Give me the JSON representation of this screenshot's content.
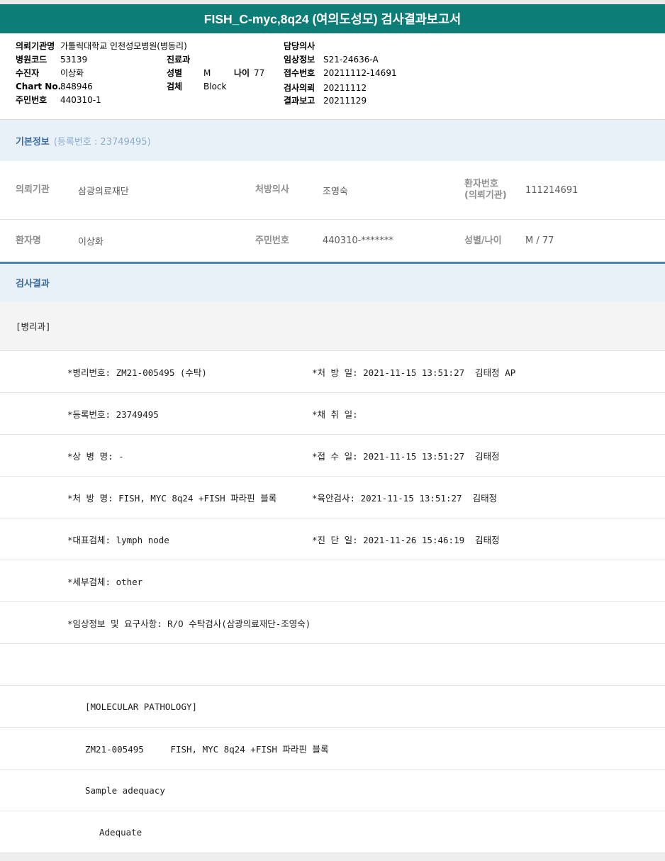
{
  "report": {
    "title": "FISH_C-myc,8q24 (여의도성모) 검사결과보고서"
  },
  "patient_header": {
    "org_label": "의뢰기관명",
    "org_value": "가톨릭대학교 인천성모병원(병동리)",
    "hospital_code_label": "병원코드",
    "hospital_code_value": "53139",
    "examinee_label": "수진자",
    "examinee_value": "이상화",
    "chart_no_label": "Chart No.",
    "chart_no_value": "848946",
    "resident_no_label": "주민번호",
    "resident_no_value": "440310-1",
    "dept_label": "진료과",
    "dept_value": "",
    "sex_label": "성별",
    "sex_value": "M",
    "age_label": "나이",
    "age_value": "77",
    "specimen_label": "검체",
    "specimen_value": "Block",
    "doctor_label": "담당의사",
    "doctor_value": "",
    "clinical_info_label": "임상정보",
    "clinical_info_value": "S21-24636-A",
    "accession_label": "접수번호",
    "accession_value": "20211112-14691",
    "request_label": "검사의뢰",
    "request_value": "20211112",
    "reported_label": "결과보고",
    "reported_value": "20211129"
  },
  "basic_info": {
    "title": "기본정보",
    "subtitle": "(등록번호 : 23749495)",
    "row1": {
      "c1_label": "의뢰기관",
      "c1_value": "삼광의료재단",
      "c2_label": "처방의사",
      "c2_value": "조영숙",
      "c3_label": "환자번호",
      "c3_label_sub": "(의뢰기관)",
      "c3_value": "111214691"
    },
    "row2": {
      "c1_label": "환자명",
      "c1_value": "이상화",
      "c2_label": "주민번호",
      "c2_value": "440310-*******",
      "c3_label": "성별/나이",
      "c3_label_sub": "",
      "c3_value": "M / 77"
    }
  },
  "results": {
    "title": "검사결과",
    "department": "[병리과]",
    "rows": [
      {
        "left": "*병리번호: ZM21-005495 (수탁)",
        "right": "*처 방 일: 2021-11-15 13:51:27  김태정 AP"
      },
      {
        "left": "*등록번호: 23749495",
        "right": "*채 취 일:"
      },
      {
        "left": "*상 병 명: -",
        "right": "*접 수 일: 2021-11-15 13:51:27  김태정"
      },
      {
        "left": "*처 방 명: FISH, MYC 8q24 +FISH 파라핀 블록",
        "right": "*육안검사: 2021-11-15 13:51:27  김태정"
      },
      {
        "left": "*대표검체: lymph node",
        "right": "*진 단 일: 2021-11-26 15:46:19  김태정"
      },
      {
        "left": "*세부검체: other",
        "right": ""
      },
      {
        "left": "*임상정보 및 요구사항: R/O 수탁검사(삼광의료재단-조영숙)",
        "right": ""
      },
      {
        "left": "",
        "right": ""
      },
      {
        "left": "[MOLECULAR PATHOLOGY]",
        "right": ""
      },
      {
        "left": "ZM21-005495     FISH, MYC 8q24 +FISH 파라핀 블록",
        "right": ""
      },
      {
        "left": "Sample adequacy",
        "right": ""
      },
      {
        "left": "Adequate",
        "right": ""
      }
    ]
  }
}
